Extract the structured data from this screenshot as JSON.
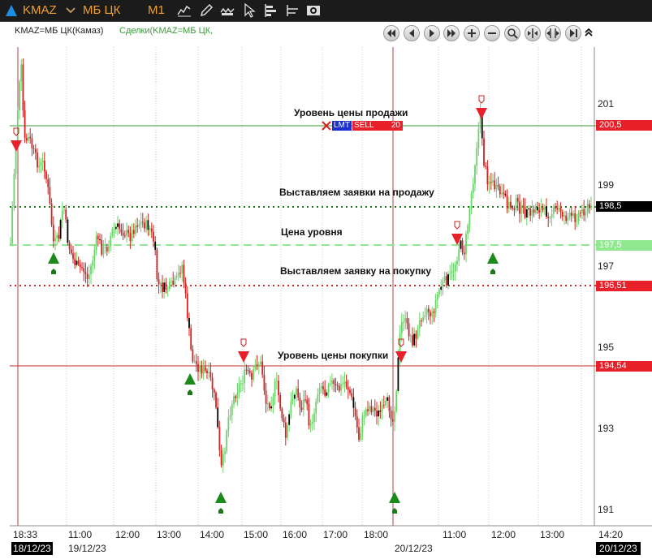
{
  "toolbar": {
    "ticker": "KMAZ",
    "board": "МБ ЦК",
    "timeframe": "M1",
    "icons": [
      "line-style-icon",
      "pencil-icon",
      "indicator-icon",
      "cursor-icon",
      "volume-profile-icon",
      "level-icon",
      "camera-icon"
    ]
  },
  "chart_header": {
    "instrument": "KMAZ=МБ ЦК(Камаз)",
    "trades": "Сделки(KMAZ=МБ ЦК,"
  },
  "order_widget": {
    "type": "LMT",
    "side": "SELL",
    "qty": "20"
  },
  "annotations": {
    "sell_level": "Уровень цены продажи",
    "place_sell": "Выставляем заявки на продажу",
    "level_price": "Цена уровня",
    "place_buy": "Выставляем заявку на покупку",
    "buy_level": "Уровень цены покупки"
  },
  "y_axis": {
    "ticks": [
      "201",
      "199",
      "197",
      "195",
      "193",
      "191"
    ]
  },
  "price_tags": [
    {
      "label": "200,5",
      "bg": "#e8202a",
      "fg": "#ffffff"
    },
    {
      "label": "198,5",
      "bg": "#000000",
      "fg": "#ffffff"
    },
    {
      "label": "197,5",
      "bg": "#90e890",
      "fg": "#ffffff"
    },
    {
      "label": "196,51",
      "bg": "#e8202a",
      "fg": "#ffffff"
    },
    {
      "label": "194,54",
      "bg": "#e8202a",
      "fg": "#ffffff"
    }
  ],
  "x_axis": {
    "ticks": [
      "18:33",
      "11:00",
      "12:00",
      "13:00",
      "14:00",
      "15:00",
      "16:00",
      "17:00",
      "18:00",
      "11:00",
      "12:00",
      "13:00",
      "14:20"
    ]
  },
  "date_labels": [
    "18/12/23",
    "19/12/23",
    "20/12/23",
    "20/12/23"
  ],
  "colors": {
    "up": "#6ad36a",
    "down": "#d42020",
    "accent": "#f0a030",
    "sell_line": "#3a9a3a",
    "buy_line": "#c03030"
  }
}
